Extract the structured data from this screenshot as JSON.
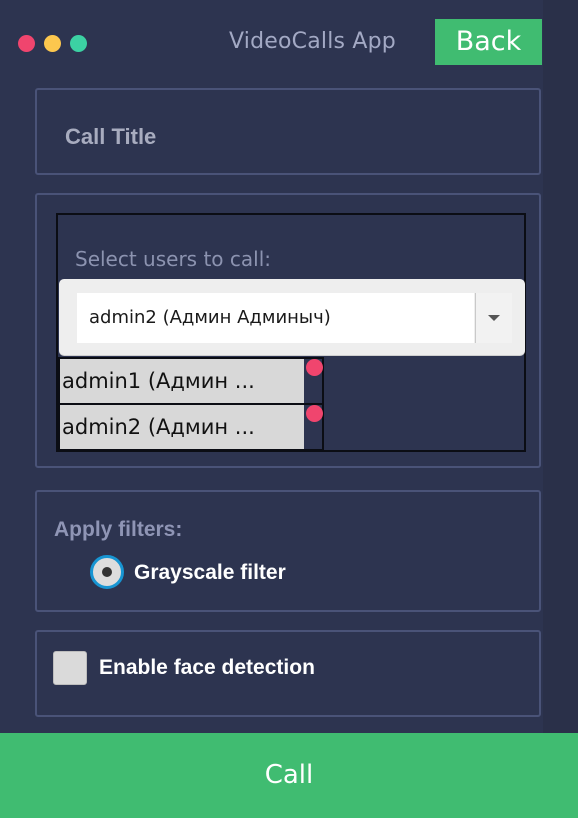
{
  "colors": {
    "background": "#2d3450",
    "accent_green": "#40bc71",
    "dot_red": "#f0456e",
    "dot_yellow": "#fcc74e",
    "dot_green": "#3cd1a3",
    "chip_remove": "#f0456e"
  },
  "titlebar": {
    "title": "VideoCalls App",
    "back_label": "Back"
  },
  "call_title": {
    "placeholder": "Call Title"
  },
  "users": {
    "label": "Select users to call:",
    "selected": "admin2 (Админ Админыч)",
    "chips": [
      {
        "label": "admin1 (Админ ..."
      },
      {
        "label": "admin2 (Админ ..."
      }
    ]
  },
  "filters": {
    "label": "Apply filters:",
    "option_label": "Grayscale filter",
    "option_selected": true
  },
  "face_detection": {
    "label": "Enable face detection",
    "checked": false
  },
  "call_button": {
    "label": "Call"
  }
}
